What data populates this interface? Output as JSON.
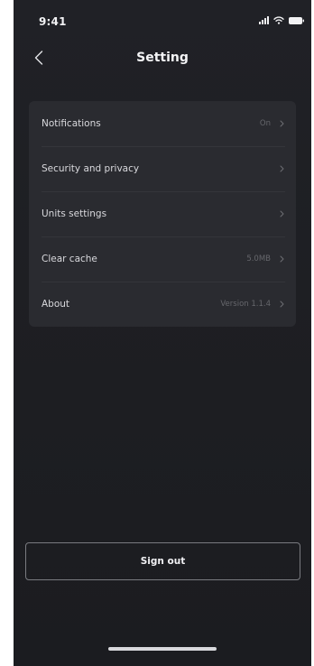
{
  "status_bar": {
    "time": "9:41",
    "icons": [
      "signal-icon",
      "wifi-icon",
      "battery-icon"
    ]
  },
  "header": {
    "title": "Setting",
    "back_icon": "chevron-left-icon"
  },
  "settings": {
    "items": [
      {
        "label": "Notifications",
        "value": "On"
      },
      {
        "label": "Security and privacy",
        "value": ""
      },
      {
        "label": "Units settings",
        "value": ""
      },
      {
        "label": "Clear cache",
        "value": "5.0MB"
      },
      {
        "label": "About",
        "value": "Version 1.1.4"
      }
    ]
  },
  "footer": {
    "sign_out_label": "Sign out"
  },
  "colors": {
    "background": "#1e1f23",
    "card": "#2a2b30",
    "text_primary": "#e9e9ec",
    "text_secondary": "#66676c"
  }
}
